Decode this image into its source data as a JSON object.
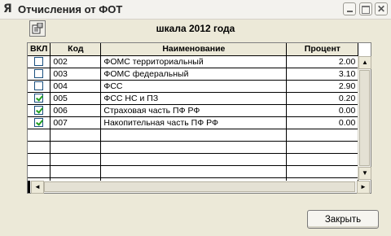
{
  "window": {
    "title": "Отчисления от ФОТ",
    "app_icon": "R-app-icon"
  },
  "toolbar": {
    "settings_icon": "form-settings-icon"
  },
  "header": {
    "title": "шкала 2012 года"
  },
  "table": {
    "columns": [
      "ВКЛ",
      "Код",
      "Наименование",
      "Процент"
    ],
    "rows": [
      {
        "checked": false,
        "code": "002",
        "name": "ФОМС территориальный",
        "percent": "2.00"
      },
      {
        "checked": false,
        "code": "003",
        "name": "ФОМС федеральный",
        "percent": "3.10"
      },
      {
        "checked": false,
        "code": "004",
        "name": "ФСС",
        "percent": "2.90"
      },
      {
        "checked": true,
        "code": "005",
        "name": "ФСС НС и ПЗ",
        "percent": "0.20"
      },
      {
        "checked": true,
        "code": "006",
        "name": "Страховая часть ПФ РФ",
        "percent": "0.00"
      },
      {
        "checked": true,
        "code": "007",
        "name": "Накопительная часть ПФ РФ",
        "percent": "0.00"
      },
      {
        "checked": null,
        "code": "",
        "name": "",
        "percent": ""
      },
      {
        "checked": null,
        "code": "",
        "name": "",
        "percent": ""
      },
      {
        "checked": null,
        "code": "",
        "name": "",
        "percent": ""
      },
      {
        "checked": null,
        "code": "",
        "name": "",
        "percent": ""
      },
      {
        "checked": null,
        "code": "",
        "name": "",
        "percent": ""
      }
    ]
  },
  "footer": {
    "close_label": "Закрыть"
  }
}
